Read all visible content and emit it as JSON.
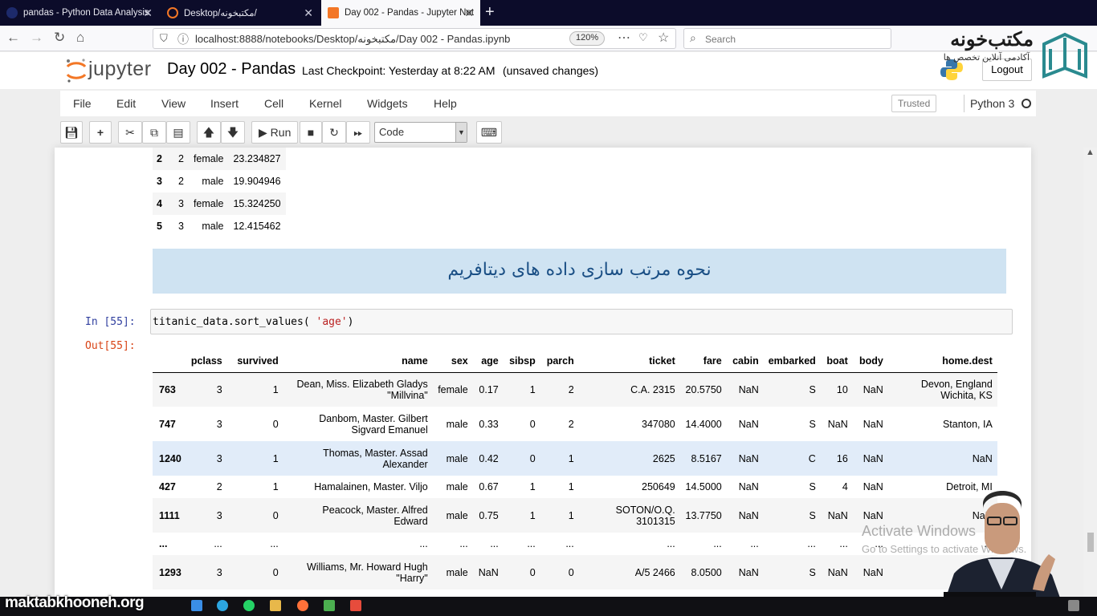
{
  "browser": {
    "tabs": [
      {
        "title": "pandas - Python Data Analysis"
      },
      {
        "title": "Desktop/مکتبخونه/"
      },
      {
        "title": "Day 002 - Pandas - Jupyter Not"
      }
    ],
    "url": "localhost:8888/notebooks/Desktop/مکتبخونه/Day 002 - Pandas.ipynb",
    "zoom": "120%",
    "search_placeholder": "Search"
  },
  "brand": {
    "title": "مکتب‌خونه",
    "subtitle": "آکادمی آنلاین تخصص ها",
    "website": "maktabkhooneh.org"
  },
  "jupyter": {
    "logo_text": "jupyter",
    "notebook_title": "Day 002 - Pandas",
    "checkpoint": "Last Checkpoint: Yesterday at 8:22 AM",
    "unsaved": "(unsaved changes)",
    "logout_label": "Logout",
    "menu": [
      "File",
      "Edit",
      "View",
      "Insert",
      "Cell",
      "Kernel",
      "Widgets",
      "Help"
    ],
    "trusted_label": "Trusted",
    "kernel_name": "Python 3",
    "run_label": "Run",
    "cell_type": "Code"
  },
  "prev_output": {
    "rows": [
      [
        "2",
        "2",
        "female",
        "23.234827"
      ],
      [
        "3",
        "2",
        "male",
        "19.904946"
      ],
      [
        "4",
        "3",
        "female",
        "15.324250"
      ],
      [
        "5",
        "3",
        "male",
        "12.415462"
      ]
    ]
  },
  "markdown_heading": "نحوه مرتب سازی داده های دیتافریم",
  "cell": {
    "in_prompt": "In [55]:",
    "code_prefix": "titanic_data.sort_values( ",
    "code_string": "'age'",
    "code_suffix": ")",
    "out_prompt": "Out[55]:"
  },
  "dataframe": {
    "columns": [
      "",
      "pclass",
      "survived",
      "name",
      "sex",
      "age",
      "sibsp",
      "parch",
      "ticket",
      "fare",
      "cabin",
      "embarked",
      "boat",
      "body",
      "home.dest"
    ],
    "rows": [
      [
        "763",
        "3",
        "1",
        "Dean, Miss. Elizabeth Gladys \"Millvina\"",
        "female",
        "0.17",
        "1",
        "2",
        "C.A. 2315",
        "20.5750",
        "NaN",
        "S",
        "10",
        "NaN",
        "Devon, England Wichita, KS"
      ],
      [
        "747",
        "3",
        "0",
        "Danbom, Master. Gilbert Sigvard Emanuel",
        "male",
        "0.33",
        "0",
        "2",
        "347080",
        "14.4000",
        "NaN",
        "S",
        "NaN",
        "NaN",
        "Stanton, IA"
      ],
      [
        "1240",
        "3",
        "1",
        "Thomas, Master. Assad Alexander",
        "male",
        "0.42",
        "0",
        "1",
        "2625",
        "8.5167",
        "NaN",
        "C",
        "16",
        "NaN",
        "NaN"
      ],
      [
        "427",
        "2",
        "1",
        "Hamalainen, Master. Viljo",
        "male",
        "0.67",
        "1",
        "1",
        "250649",
        "14.5000",
        "NaN",
        "S",
        "4",
        "NaN",
        "Detroit, MI"
      ],
      [
        "1111",
        "3",
        "0",
        "Peacock, Master. Alfred Edward",
        "male",
        "0.75",
        "1",
        "1",
        "SOTON/O.Q. 3101315",
        "13.7750",
        "NaN",
        "S",
        "NaN",
        "NaN",
        "NaN"
      ],
      [
        "...",
        "...",
        "...",
        "...",
        "...",
        "...",
        "...",
        "...",
        "...",
        "...",
        "...",
        "...",
        "...",
        "...",
        "..."
      ],
      [
        "1293",
        "3",
        "0",
        "Williams, Mr. Howard Hugh \"Harry\"",
        "male",
        "NaN",
        "0",
        "0",
        "A/5 2466",
        "8.0500",
        "NaN",
        "S",
        "NaN",
        "NaN",
        ""
      ]
    ],
    "highlight_row": 2
  },
  "overlay": {
    "activate_title": "Activate Windows",
    "activate_sub": "Go to Settings to activate Windows."
  },
  "colors": {
    "jupyter_orange": "#f37726",
    "banner_bg": "#cfe3f2",
    "in_prompt": "#303f9f",
    "out_prompt": "#d84315",
    "tab_strip": "#0c0c2a"
  }
}
